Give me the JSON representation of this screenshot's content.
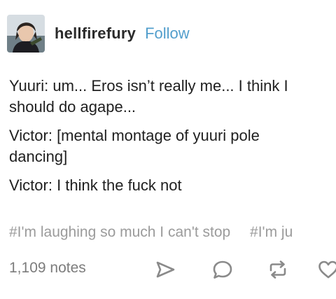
{
  "post": {
    "username": "hellfirefury",
    "follow_label": "Follow",
    "avatar_icon": "user-avatar",
    "body": [
      "Yuuri: um... Eros isn’t really me... I think I",
      "should do agape...",
      "Victor: [mental montage of yuuri pole",
      "dancing]",
      "Victor: I think the fuck not"
    ],
    "tags": [
      "#I'm laughing so much I can't stop",
      "#I'm ju"
    ],
    "notes": "1,109 notes",
    "actions": {
      "share_icon": "share-icon",
      "reply_icon": "reply-icon",
      "reblog_icon": "reblog-icon",
      "like_icon": "heart-icon"
    },
    "colors": {
      "follow": "#529ecc",
      "text": "#1f1f1f",
      "tags": "#9b9b9b",
      "icons": "#8a8a8a"
    }
  }
}
